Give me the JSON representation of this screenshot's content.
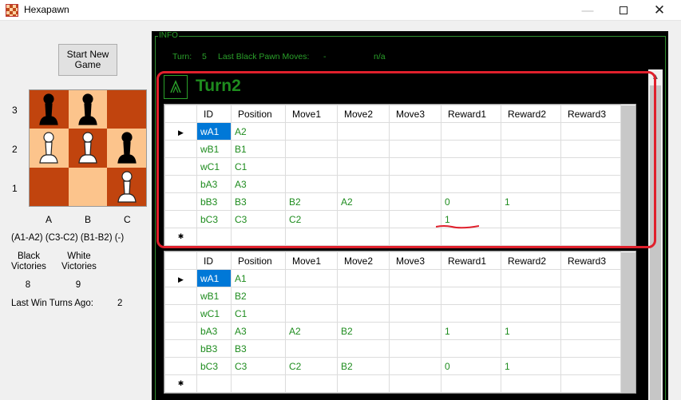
{
  "window": {
    "title": "Hexapawn",
    "minimize": "—",
    "close": "✕"
  },
  "left": {
    "start_button": "Start New Game",
    "ranks": [
      "3",
      "2",
      "1"
    ],
    "files": [
      "A",
      "B",
      "C"
    ],
    "board": [
      [
        {
          "color": "dark",
          "piece": "black"
        },
        {
          "color": "light",
          "piece": "black"
        },
        {
          "color": "dark",
          "piece": ""
        }
      ],
      [
        {
          "color": "light",
          "piece": "white"
        },
        {
          "color": "dark",
          "piece": "white"
        },
        {
          "color": "light",
          "piece": "black"
        }
      ],
      [
        {
          "color": "dark",
          "piece": ""
        },
        {
          "color": "light",
          "piece": ""
        },
        {
          "color": "dark",
          "piece": "white"
        }
      ]
    ],
    "moves_text": "(A1-A2) (C3-C2) (B1-B2) (-)",
    "black_victories_label": "Black Victories",
    "white_victories_label": "White Victories",
    "black_victories": "8",
    "white_victories": "9",
    "last_win_label": "Last Win Turns Ago:",
    "last_win_value": "2"
  },
  "info": {
    "legend": "INFO",
    "turn_label": "Turn:",
    "turn_value": "5",
    "last_black_label": "Last Black Pawn Moves:",
    "last_black_dash": "-",
    "last_black_value": "n/a"
  },
  "turn_block": {
    "title": "Turn2"
  },
  "columns": [
    "ID",
    "Position",
    "Move1",
    "Move2",
    "Move3",
    "Reward1",
    "Reward2",
    "Reward3"
  ],
  "grid1": {
    "rows": [
      [
        "wA1",
        "A2",
        "",
        "",
        "",
        "",
        "",
        ""
      ],
      [
        "wB1",
        "B1",
        "",
        "",
        "",
        "",
        "",
        ""
      ],
      [
        "wC1",
        "C1",
        "",
        "",
        "",
        "",
        "",
        ""
      ],
      [
        "bA3",
        "A3",
        "",
        "",
        "",
        "",
        "",
        ""
      ],
      [
        "bB3",
        "B3",
        "B2",
        "A2",
        "",
        "0",
        "1",
        ""
      ],
      [
        "bC3",
        "C3",
        "C2",
        "",
        "",
        "1",
        "",
        ""
      ]
    ]
  },
  "grid2": {
    "rows": [
      [
        "wA1",
        "A1",
        "",
        "",
        "",
        "",
        "",
        ""
      ],
      [
        "wB1",
        "B2",
        "",
        "",
        "",
        "",
        "",
        ""
      ],
      [
        "wC1",
        "C1",
        "",
        "",
        "",
        "",
        "",
        ""
      ],
      [
        "bA3",
        "A3",
        "A2",
        "B2",
        "",
        "1",
        "1",
        ""
      ],
      [
        "bB3",
        "B3",
        "",
        "",
        "",
        "",
        "",
        ""
      ],
      [
        "bC3",
        "C3",
        "C2",
        "B2",
        "",
        "0",
        "1",
        ""
      ]
    ]
  },
  "grid_markers": {
    "current": "▶",
    "new": "✱"
  },
  "colors": {
    "dark_square": "#c1440e",
    "light_square": "#fcc48c",
    "info_green": "#2aa02a",
    "highlight_red": "#e0202c",
    "selection_blue": "#0078d7"
  }
}
